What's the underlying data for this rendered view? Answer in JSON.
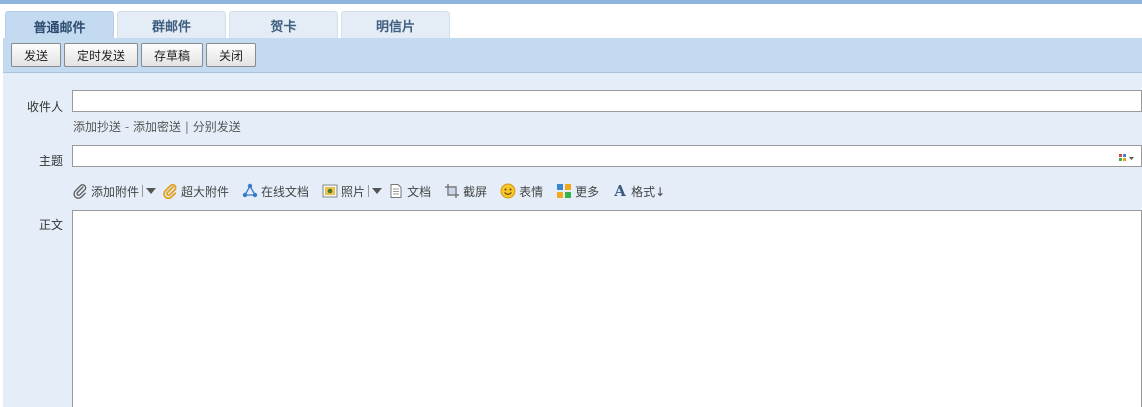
{
  "tabs": [
    {
      "label": "普通邮件",
      "active": true
    },
    {
      "label": "群邮件",
      "active": false
    },
    {
      "label": "贺卡",
      "active": false
    },
    {
      "label": "明信片",
      "active": false
    }
  ],
  "toolbar": {
    "send_label": "发送",
    "scheduled_send_label": "定时发送",
    "save_draft_label": "存草稿",
    "close_label": "关闭"
  },
  "compose": {
    "to_label": "收件人",
    "to_value": "",
    "add_cc_label": "添加抄送",
    "link_dash": "-",
    "add_bcc_label": "添加密送",
    "link_pipe": "|",
    "separate_send_label": "分别发送",
    "subject_label": "主题",
    "subject_value": "",
    "body_label": "正文",
    "body_value": ""
  },
  "attach_toolbar": [
    {
      "label": "添加附件",
      "icon": "paperclip-icon"
    },
    {
      "label": "超大附件",
      "icon": "large-attachment-icon"
    },
    {
      "label": "在线文档",
      "icon": "online-doc-icon"
    },
    {
      "label": "照片",
      "icon": "photo-icon"
    },
    {
      "label": "文档",
      "icon": "document-icon"
    },
    {
      "label": "截屏",
      "icon": "screenshot-icon"
    },
    {
      "label": "表情",
      "icon": "smiley-icon"
    },
    {
      "label": "更多",
      "icon": "more-icon"
    },
    {
      "label": "格式↓",
      "icon": "format-icon"
    }
  ],
  "colors": {
    "accent": "#c4daf1",
    "panel": "#e5eef8",
    "top_line": "#8fb4df"
  }
}
